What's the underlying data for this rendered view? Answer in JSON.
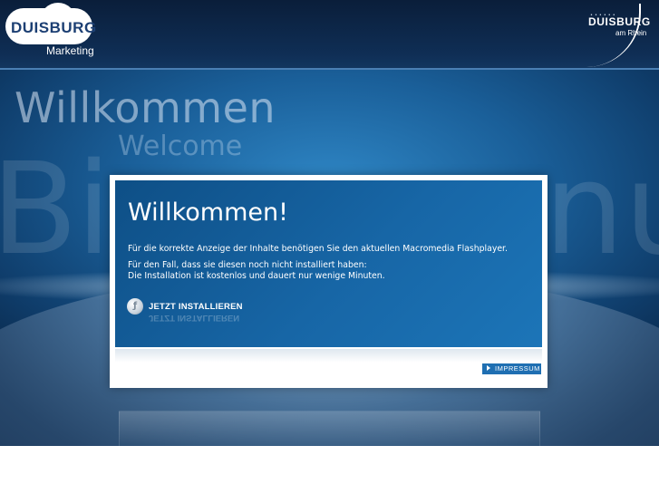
{
  "header": {
    "logo_left_word": "DUISBURG",
    "logo_left_sub": "Marketing",
    "logo_right_word": "DUISBURG",
    "logo_right_sub": "am Rhein"
  },
  "background": {
    "headline_de": "Willkommen",
    "headline_en": "Welcome",
    "watermark_left": "Bi",
    "watermark_right": "nu"
  },
  "card": {
    "title": "Willkommen!",
    "line1": "Für die korrekte Anzeige der Inhalte benötigen Sie den aktuellen Macromedia Flashplayer.",
    "line2": "Für den Fall, dass sie diesen noch nicht installiert haben:",
    "line3": "Die Installation ist kostenlos und dauert nur wenige Minuten.",
    "install_label": "JETZT INSTALLIEREN",
    "impressum_label": "IMPRESSUM"
  },
  "colors": {
    "brand_dark": "#0a1e3a",
    "card_blue": "#1766a6",
    "button_blue": "#1f6fb2"
  }
}
